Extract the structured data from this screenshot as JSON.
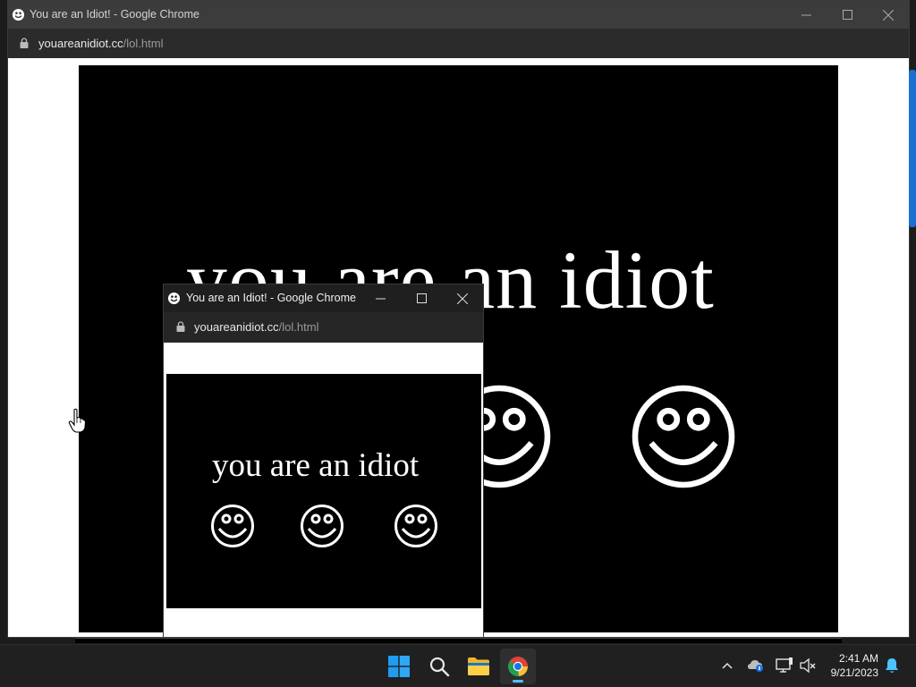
{
  "big_window": {
    "title": "You are an Idiot! - Google Chrome",
    "url_host": "youareanidiot.cc",
    "url_path": "/lol.html",
    "page_text": "you are an idiot"
  },
  "small_window": {
    "title": "You are an Idiot! - Google Chrome",
    "url_host": "youareanidiot.cc",
    "url_path": "/lol.html",
    "page_text": "you are an idiot"
  },
  "taskbar": {
    "apps": [
      {
        "name": "start",
        "icon": "windows-logo-icon"
      },
      {
        "name": "search",
        "icon": "search-icon"
      },
      {
        "name": "file-explorer",
        "icon": "folder-icon"
      },
      {
        "name": "chrome",
        "icon": "chrome-icon",
        "active": true
      }
    ],
    "clock_time": "2:41 AM",
    "clock_date": "9/21/2023"
  },
  "colors": {
    "page_bg": "#000000",
    "page_fg": "#ffffff",
    "titlebar_active": "#1f1f1f",
    "titlebar_inactive": "#3c3c3c",
    "taskbar": "#202020",
    "accent": "#4cc2ff"
  }
}
